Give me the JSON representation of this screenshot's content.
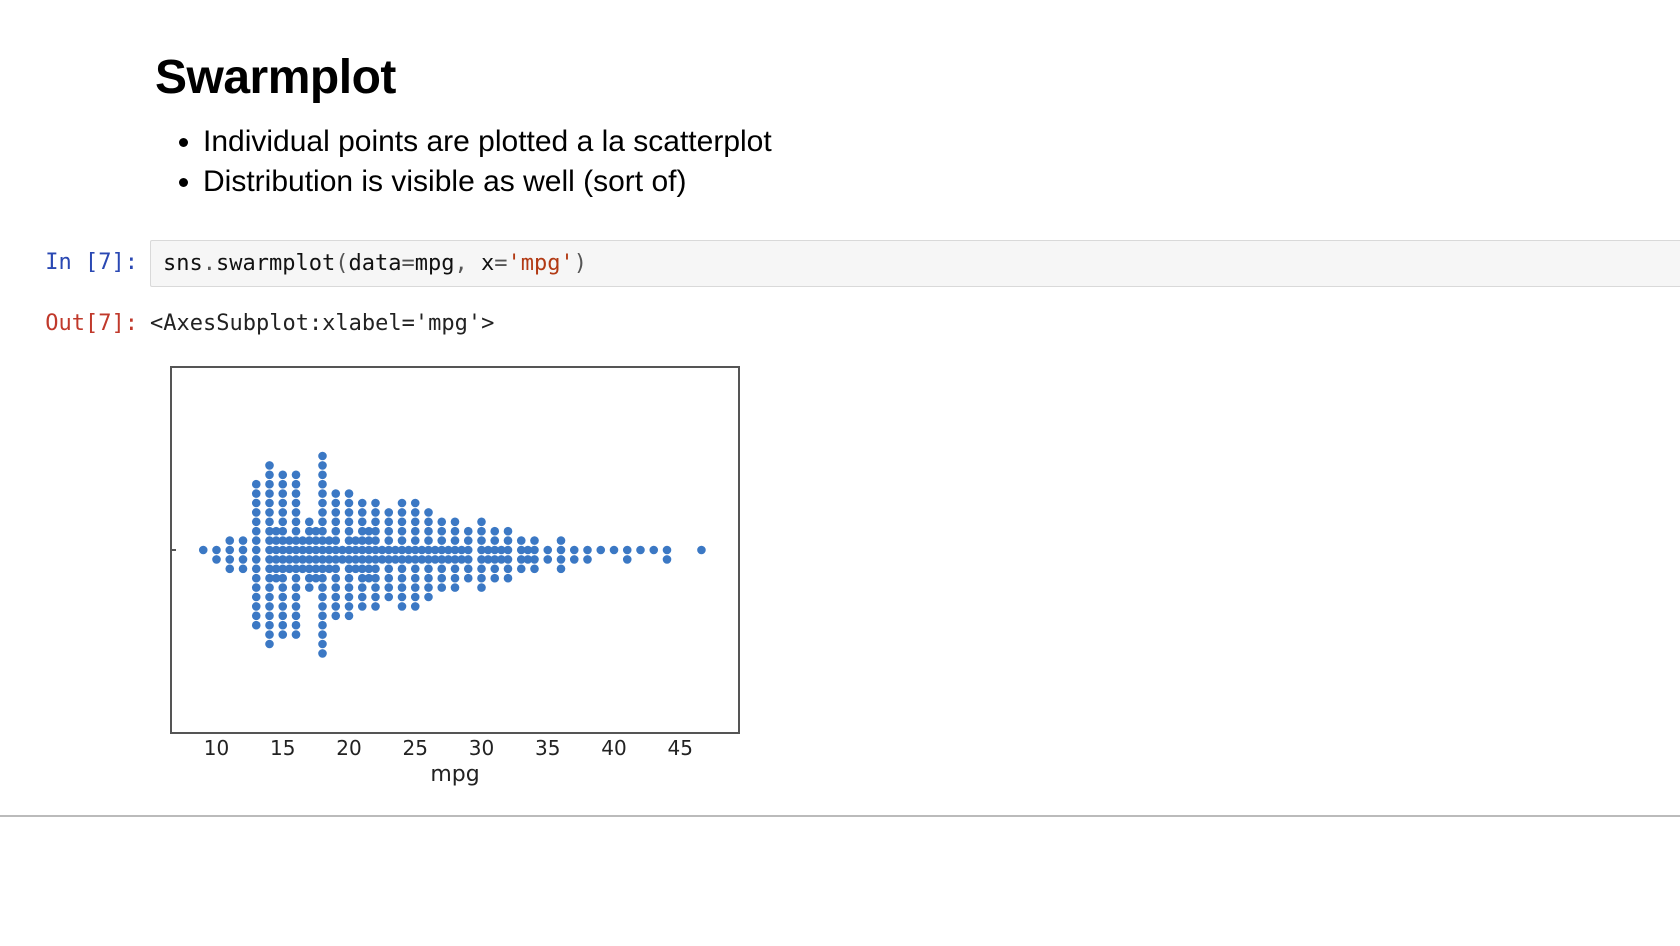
{
  "heading": "Swarmplot",
  "bullets": [
    "Individual points are plotted a la scatterplot",
    "Distribution is visible as well (sort of)"
  ],
  "cell": {
    "exec_count": 7,
    "in_prompt": "In [7]:",
    "out_prompt": "Out[7]:",
    "code_plain": "sns.swarmplot(data=mpg, x='mpg')",
    "code_tokens": [
      {
        "t": "sns",
        "c": "tok-name"
      },
      {
        "t": ".",
        "c": "tok-op"
      },
      {
        "t": "swarmplot",
        "c": "tok-name"
      },
      {
        "t": "(",
        "c": "tok-op"
      },
      {
        "t": "data",
        "c": "tok-name"
      },
      {
        "t": "=",
        "c": "tok-op"
      },
      {
        "t": "mpg",
        "c": "tok-name"
      },
      {
        "t": ", ",
        "c": "tok-op"
      },
      {
        "t": "x",
        "c": "tok-name"
      },
      {
        "t": "=",
        "c": "tok-op"
      },
      {
        "t": "'mpg'",
        "c": "tok-str"
      },
      {
        "t": ")",
        "c": "tok-op"
      }
    ],
    "output_text": "<AxesSubplot:xlabel='mpg'>"
  },
  "chart_data": {
    "type": "swarm",
    "xlabel": "mpg",
    "ylabel": "",
    "xlim": [
      8,
      48
    ],
    "x_ticks": [
      10,
      15,
      20,
      25,
      30,
      35,
      40,
      45
    ],
    "point_color": "#3b78c4",
    "point_radius_px": 4.3,
    "counts_per_x": [
      {
        "x": 9,
        "n": 1
      },
      {
        "x": 10,
        "n": 2
      },
      {
        "x": 11,
        "n": 4
      },
      {
        "x": 12,
        "n": 4
      },
      {
        "x": 13,
        "n": 16
      },
      {
        "x": 14,
        "n": 20
      },
      {
        "x": 14.5,
        "n": 6
      },
      {
        "x": 15,
        "n": 18
      },
      {
        "x": 15.5,
        "n": 4
      },
      {
        "x": 16,
        "n": 18
      },
      {
        "x": 16.5,
        "n": 4
      },
      {
        "x": 17,
        "n": 8
      },
      {
        "x": 17.5,
        "n": 6
      },
      {
        "x": 18,
        "n": 22
      },
      {
        "x": 18.5,
        "n": 4
      },
      {
        "x": 19,
        "n": 14
      },
      {
        "x": 19.5,
        "n": 2
      },
      {
        "x": 20,
        "n": 14
      },
      {
        "x": 20.5,
        "n": 4
      },
      {
        "x": 21,
        "n": 12
      },
      {
        "x": 21.5,
        "n": 6
      },
      {
        "x": 22,
        "n": 12
      },
      {
        "x": 22.5,
        "n": 2
      },
      {
        "x": 23,
        "n": 10
      },
      {
        "x": 23.5,
        "n": 2
      },
      {
        "x": 24,
        "n": 12
      },
      {
        "x": 24.5,
        "n": 2
      },
      {
        "x": 25,
        "n": 12
      },
      {
        "x": 25.5,
        "n": 2
      },
      {
        "x": 26,
        "n": 10
      },
      {
        "x": 26.5,
        "n": 2
      },
      {
        "x": 27,
        "n": 8
      },
      {
        "x": 27.5,
        "n": 2
      },
      {
        "x": 28,
        "n": 8
      },
      {
        "x": 28.5,
        "n": 2
      },
      {
        "x": 29,
        "n": 6
      },
      {
        "x": 30,
        "n": 8
      },
      {
        "x": 30.5,
        "n": 2
      },
      {
        "x": 31,
        "n": 6
      },
      {
        "x": 31.5,
        "n": 2
      },
      {
        "x": 32,
        "n": 6
      },
      {
        "x": 33,
        "n": 4
      },
      {
        "x": 33.5,
        "n": 2
      },
      {
        "x": 34,
        "n": 4
      },
      {
        "x": 35,
        "n": 2
      },
      {
        "x": 36,
        "n": 4
      },
      {
        "x": 37,
        "n": 2
      },
      {
        "x": 38,
        "n": 2
      },
      {
        "x": 39,
        "n": 1
      },
      {
        "x": 40,
        "n": 1
      },
      {
        "x": 41,
        "n": 2
      },
      {
        "x": 42,
        "n": 1
      },
      {
        "x": 43,
        "n": 1
      },
      {
        "x": 44,
        "n": 2
      },
      {
        "x": 46.6,
        "n": 1
      }
    ]
  }
}
